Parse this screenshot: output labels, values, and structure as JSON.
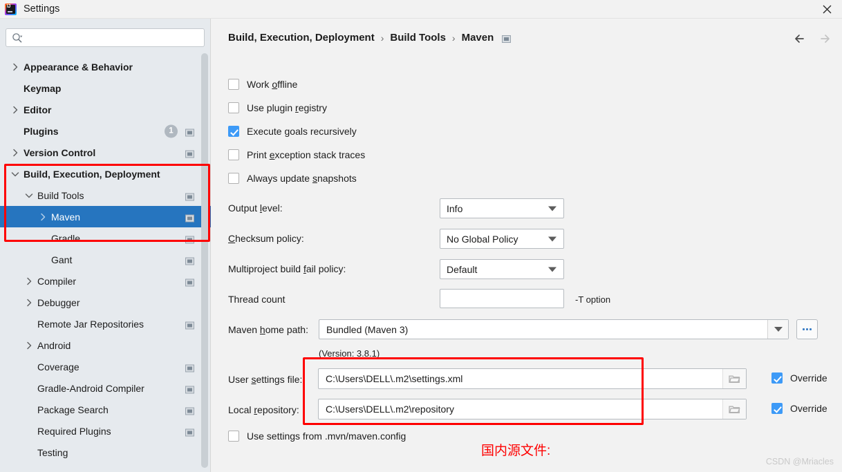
{
  "window": {
    "title": "Settings",
    "logo_icon": "intellij-idea-logo",
    "close_icon": "close-icon"
  },
  "sidebar": {
    "search": {
      "placeholder": "",
      "value": "",
      "icon": "search-icon"
    },
    "items": [
      {
        "label": "Appearance & Behavior",
        "indent": 0,
        "arrow": "chevron-right",
        "bold": true,
        "icon": false,
        "badge": null,
        "selected": false
      },
      {
        "label": "Keymap",
        "indent": 0,
        "arrow": "none",
        "bold": true,
        "icon": false,
        "badge": null,
        "selected": false
      },
      {
        "label": "Editor",
        "indent": 0,
        "arrow": "chevron-right",
        "bold": true,
        "icon": false,
        "badge": null,
        "selected": false
      },
      {
        "label": "Plugins",
        "indent": 0,
        "arrow": "none",
        "bold": true,
        "icon": true,
        "badge": "1",
        "selected": false
      },
      {
        "label": "Version Control",
        "indent": 0,
        "arrow": "chevron-right",
        "bold": true,
        "icon": true,
        "badge": null,
        "selected": false
      },
      {
        "label": "Build, Execution, Deployment",
        "indent": 0,
        "arrow": "chevron-down",
        "bold": true,
        "icon": false,
        "badge": null,
        "selected": false
      },
      {
        "label": "Build Tools",
        "indent": 1,
        "arrow": "chevron-down",
        "bold": false,
        "icon": true,
        "badge": null,
        "selected": false
      },
      {
        "label": "Maven",
        "indent": 2,
        "arrow": "chevron-right",
        "bold": false,
        "icon": true,
        "badge": null,
        "selected": true
      },
      {
        "label": "Gradle",
        "indent": 2,
        "arrow": "none",
        "bold": false,
        "icon": true,
        "badge": null,
        "selected": false
      },
      {
        "label": "Gant",
        "indent": 2,
        "arrow": "none",
        "bold": false,
        "icon": true,
        "badge": null,
        "selected": false
      },
      {
        "label": "Compiler",
        "indent": 1,
        "arrow": "chevron-right",
        "bold": false,
        "icon": true,
        "badge": null,
        "selected": false
      },
      {
        "label": "Debugger",
        "indent": 1,
        "arrow": "chevron-right",
        "bold": false,
        "icon": false,
        "badge": null,
        "selected": false
      },
      {
        "label": "Remote Jar Repositories",
        "indent": 1,
        "arrow": "none",
        "bold": false,
        "icon": true,
        "badge": null,
        "selected": false
      },
      {
        "label": "Android",
        "indent": 1,
        "arrow": "chevron-right",
        "bold": false,
        "icon": false,
        "badge": null,
        "selected": false
      },
      {
        "label": "Coverage",
        "indent": 1,
        "arrow": "none",
        "bold": false,
        "icon": true,
        "badge": null,
        "selected": false
      },
      {
        "label": "Gradle-Android Compiler",
        "indent": 1,
        "arrow": "none",
        "bold": false,
        "icon": true,
        "badge": null,
        "selected": false
      },
      {
        "label": "Package Search",
        "indent": 1,
        "arrow": "none",
        "bold": false,
        "icon": true,
        "badge": null,
        "selected": false
      },
      {
        "label": "Required Plugins",
        "indent": 1,
        "arrow": "none",
        "bold": false,
        "icon": true,
        "badge": null,
        "selected": false
      },
      {
        "label": "Testing",
        "indent": 1,
        "arrow": "none",
        "bold": false,
        "icon": false,
        "badge": null,
        "selected": false
      }
    ]
  },
  "breadcrumb": {
    "crumb1": "Build, Execution, Deployment",
    "crumb2": "Build Tools",
    "crumb3": "Maven",
    "separator": "›",
    "trailing_icon": "settings-sync-icon"
  },
  "nav": {
    "back_icon": "arrow-left-icon",
    "forward_icon": "arrow-right-icon"
  },
  "main": {
    "checkboxes": [
      {
        "label_pre": "Work ",
        "mnemonic": "o",
        "label_post": "ffline",
        "checked": false
      },
      {
        "label_pre": "Use plugin ",
        "mnemonic": "r",
        "label_post": "egistry",
        "checked": false
      },
      {
        "label_pre": "Execute ",
        "mnemonic": "g",
        "label_post": "oals recursively",
        "checked": true
      },
      {
        "label_pre": "Print ",
        "mnemonic": "e",
        "label_post": "xception stack traces",
        "checked": false
      },
      {
        "label_pre": "Always update ",
        "mnemonic": "s",
        "label_post": "napshots",
        "checked": false
      }
    ],
    "output_level": {
      "label_pre": "Output ",
      "mnemonic": "l",
      "label_post": "evel:",
      "value": "Info"
    },
    "checksum_policy": {
      "label_pre": "",
      "mnemonic": "C",
      "label_post": "hecksum policy:",
      "value": "No Global Policy"
    },
    "fail_policy": {
      "label_pre": "Multiproject build ",
      "mnemonic": "f",
      "label_post": "ail policy:",
      "value": "Default"
    },
    "thread_count": {
      "label": "Thread count",
      "value": "",
      "hint": "-T option"
    },
    "maven_home": {
      "label_pre": "Maven ",
      "mnemonic": "h",
      "label_post": "ome path:",
      "value": "Bundled (Maven 3)",
      "version": "(Version: 3.8.1)",
      "browse_label": "...",
      "browse_icon": "ellipsis-icon",
      "dropdown_icon": "chevron-down-icon"
    },
    "user_settings_file": {
      "label_pre": "User ",
      "mnemonic": "s",
      "label_post": "ettings file:",
      "value": "C:\\Users\\DELL\\.m2\\settings.xml",
      "folder_icon": "folder-icon",
      "override_label": "Override",
      "override_checked": true
    },
    "local_repository": {
      "label_pre": "Local ",
      "mnemonic": "r",
      "label_post": "epository:",
      "value": "C:\\Users\\DELL\\.m2\\repository",
      "folder_icon": "folder-icon",
      "override_label": "Override",
      "override_checked": true
    },
    "mvn_config": {
      "label": "Use settings from .mvn/maven.config",
      "checked": false
    }
  },
  "annotations": {
    "note_text": "国内源文件:",
    "color": "#fe0000"
  },
  "watermark": "CSDN @Mriacles",
  "colors": {
    "selection_blue": "#2675bf",
    "checkbox_blue": "#3d9af7",
    "sidebar_bg": "#e6eaee",
    "panel_bg": "#f2f2f2",
    "annotation_red": "#fe0000"
  }
}
